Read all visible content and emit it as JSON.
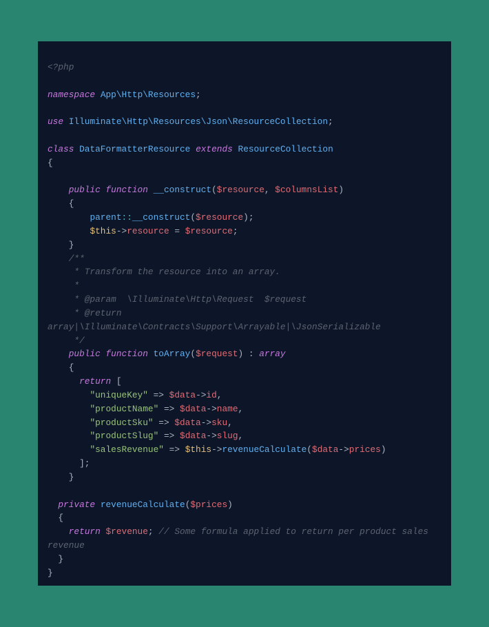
{
  "code": {
    "open_tag": "<?php",
    "ns_kw": "namespace",
    "ns_path": "App\\Http\\Resources",
    "use_kw": "use",
    "use_path": "Illuminate\\Http\\Resources\\Json\\ResourceCollection",
    "class_kw": "class",
    "class_name": "DataFormatterResource",
    "extends_kw": "extends",
    "parent_class": "ResourceCollection",
    "public_kw": "public",
    "private_kw": "private",
    "function_kw": "function",
    "return_kw": "return",
    "ctor_name": "__construct",
    "param_resource": "$resource",
    "param_columns": "$columnsList",
    "parent_ref": "parent",
    "scope_op": "::",
    "this_ref": "$this",
    "arrow": "->",
    "prop_resource": "resource",
    "assign_resource": "$resource",
    "doc_open": "/**",
    "doc_l1": " * Transform the resource into an array.",
    "doc_l2": " *",
    "doc_l3": " * @param  \\Illuminate\\Http\\Request  $request",
    "doc_l4": " * @return array|\\Illuminate\\Contracts\\Support\\Arrayable|\\JsonSerializable",
    "doc_close": " */",
    "toArray_name": "toArray",
    "param_request": "$request",
    "ret_type": "array",
    "key_unique": "\"uniqueKey\"",
    "key_name": "\"productName\"",
    "key_sku": "\"productSku\"",
    "key_slug": "\"productSlug\"",
    "key_revenue": "\"salesRevenue\"",
    "fat_arrow": "=>",
    "data_var": "$data",
    "prop_id": "id",
    "prop_name": "name",
    "prop_sku": "sku",
    "prop_slug": "slug",
    "prop_prices": "prices",
    "revenue_fn": "revenueCalculate",
    "param_prices": "$prices",
    "revenue_var": "$revenue",
    "inline_comment": "// Some formula applied to return per product sales revenue"
  }
}
